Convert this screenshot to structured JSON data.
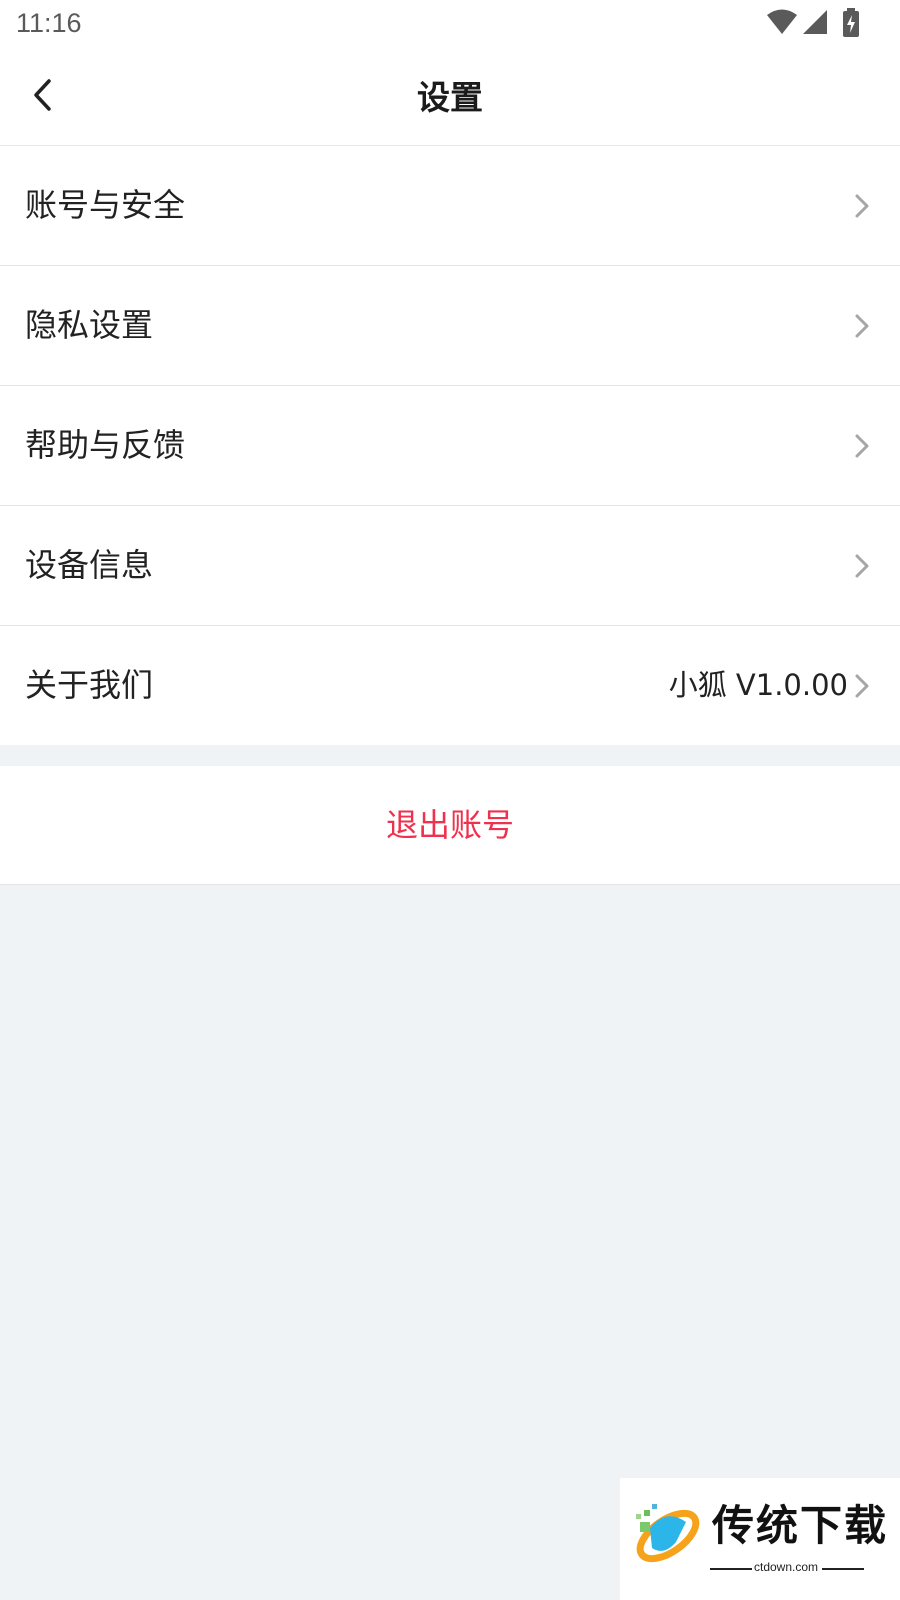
{
  "status_bar": {
    "time": "11:16",
    "icons": [
      "wifi-icon",
      "signal-icon",
      "battery-charging-icon"
    ]
  },
  "header": {
    "title": "设置",
    "back_icon": "chevron-left-icon"
  },
  "menu": {
    "items": [
      {
        "label": "账号与安全",
        "value": ""
      },
      {
        "label": "隐私设置",
        "value": ""
      },
      {
        "label": "帮助与反馈",
        "value": ""
      },
      {
        "label": "设备信息",
        "value": ""
      },
      {
        "label": "关于我们",
        "value": "小狐 V1.0.00"
      }
    ]
  },
  "logout": {
    "label": "退出账号",
    "color": "#f0314e"
  },
  "watermark": {
    "text": "传统下载",
    "url": "ctdown.com"
  },
  "colors": {
    "background": "#f0f3f6",
    "surface": "#ffffff",
    "divider": "#e4e4e4",
    "chevron": "#a6a6a6"
  }
}
